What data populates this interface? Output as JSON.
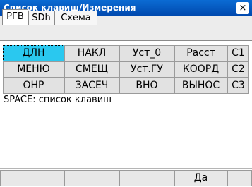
{
  "window": {
    "title": "Список клавиш/Измерения",
    "close_label": "×"
  },
  "tabs": [
    {
      "label": "РГВ",
      "active": true
    },
    {
      "label": "SDh",
      "active": false
    },
    {
      "label": "Схема",
      "active": false
    }
  ],
  "keys": {
    "row1": [
      "ДЛН",
      "НАКЛ",
      "Уст_0",
      "Расст",
      "C1"
    ],
    "row2": [
      "МЕНЮ",
      "СМЕЩ",
      "Уст.ГУ",
      "КООРД",
      "C2"
    ],
    "row3": [
      "ОНР",
      "ЗАСЕЧ",
      "ВНО",
      "ВЫНОС",
      "C3"
    ],
    "selected": "ДЛН"
  },
  "hint": "SPACE: список клавиш",
  "softkeys": [
    "",
    "",
    "",
    "Да",
    ""
  ],
  "colors": {
    "titlebar": "#0a5bc4",
    "selected_key": "#2ac8ef"
  }
}
